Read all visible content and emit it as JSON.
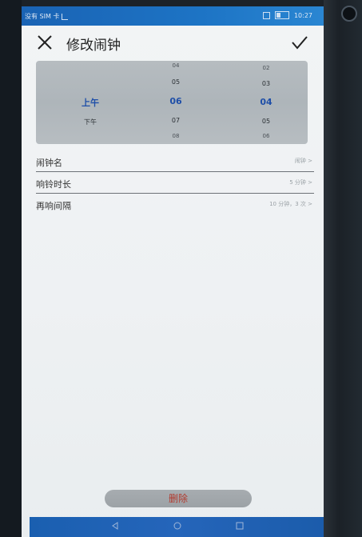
{
  "statusbar": {
    "carrier": "没有 SIM 卡",
    "time": "10:27"
  },
  "header": {
    "title": "修改闹钟"
  },
  "picker": {
    "ampm": {
      "selected": "上午",
      "next": "下午"
    },
    "hours": {
      "far_above": "04",
      "above": "05",
      "selected": "06",
      "below": "07",
      "far_below": "08"
    },
    "minutes": {
      "far_above": "02",
      "above": "03",
      "selected": "04",
      "below": "05",
      "far_below": "06"
    }
  },
  "settings": [
    {
      "label": "闹钟名",
      "value": "闹钟 >"
    },
    {
      "label": "响铃时长",
      "value": "5 分钟 >"
    },
    {
      "label": "再响间隔",
      "value": "10 分钟，3 次 >"
    }
  ],
  "delete_label": "删除",
  "colors": {
    "accent": "#1f4fa8",
    "delete": "#b23a2e",
    "statusbar": "#1d74c5"
  }
}
